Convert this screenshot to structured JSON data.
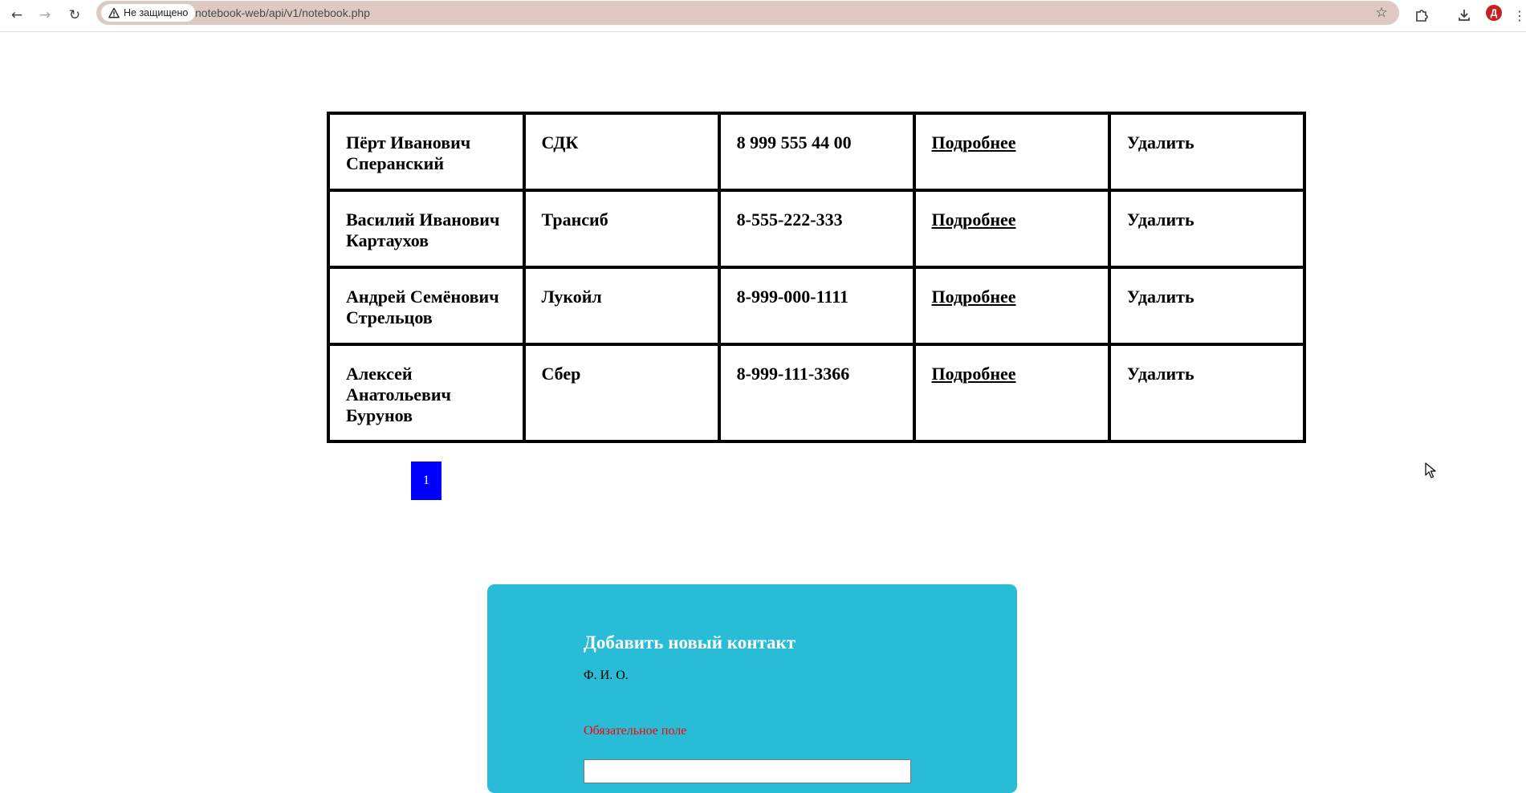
{
  "browser": {
    "security_label": "Не защищено",
    "url": "notebook-web/api/v1/notebook.php",
    "profile_initial": "Д",
    "accent_color": "#c5221f"
  },
  "contacts": [
    {
      "name": "Пёрт Иванович Сперанский",
      "company": "СДК",
      "phone": "8 999 555 44 00",
      "details": "Подробнее",
      "delete": "Удалить"
    },
    {
      "name": "Василий Иванович Картаухов",
      "company": "Трансиб",
      "phone": "8-555-222-333",
      "details": "Подробнее",
      "delete": "Удалить"
    },
    {
      "name": "Андрей Семёнович Стрельцов",
      "company": "Лукойл",
      "phone": "8-999-000-1111",
      "details": "Подробнее",
      "delete": "Удалить"
    },
    {
      "name": "Алексей Анатольевич Бурунов",
      "company": "Сбер",
      "phone": "8-999-111-3366",
      "details": "Подробнее",
      "delete": "Удалить"
    }
  ],
  "pagination": {
    "current_page": "1",
    "active_color": "#0000ff"
  },
  "add_form": {
    "title": "Добавить новый контакт",
    "name_label": "Ф. И. О.",
    "name_error": "Обязательное поле",
    "name_value": "",
    "background_color": "#29bcd6"
  }
}
